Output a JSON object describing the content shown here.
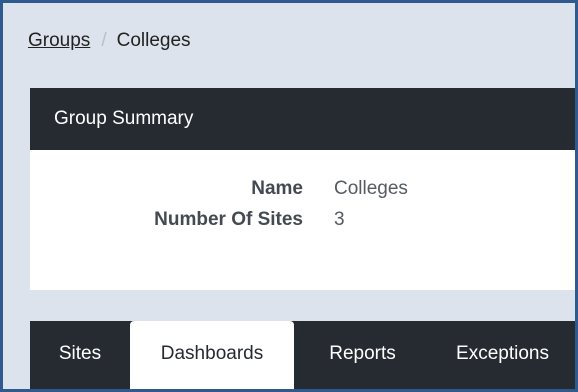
{
  "breadcrumb": {
    "groups_link": "Groups",
    "separator": "/",
    "current": "Colleges"
  },
  "summary": {
    "title": "Group Summary",
    "fields": [
      {
        "label": "Name",
        "value": "Colleges"
      },
      {
        "label": "Number Of Sites",
        "value": "3"
      }
    ]
  },
  "tabs": [
    {
      "label": "Sites",
      "active": false
    },
    {
      "label": "Dashboards",
      "active": true
    },
    {
      "label": "Reports",
      "active": false
    },
    {
      "label": "Exceptions",
      "active": false
    }
  ],
  "colors": {
    "frame_border": "#2f5a8f",
    "page_background": "#dde3ec",
    "header_background": "#262b31",
    "active_tab_background": "#ffffff"
  }
}
